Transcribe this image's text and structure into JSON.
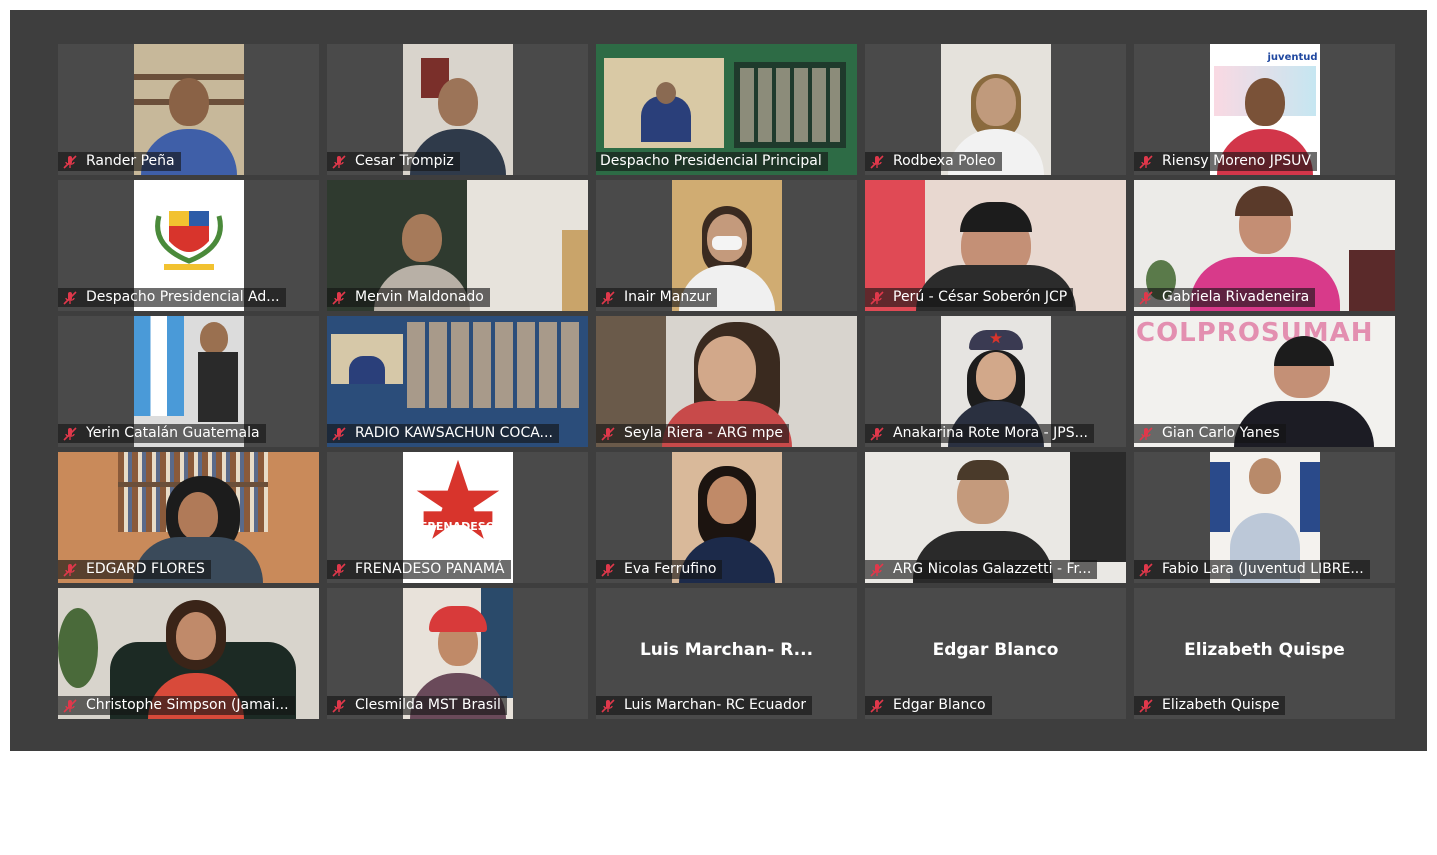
{
  "meeting": {
    "tiles": [
      {
        "label": "Rander Peña",
        "muted": true
      },
      {
        "label": "Cesar Trompiz",
        "muted": true
      },
      {
        "label": "Despacho Presidencial Principal",
        "muted": false,
        "active": true
      },
      {
        "label": "Rodbexa Poleo",
        "muted": true
      },
      {
        "label": "Riensy Moreno  JPSUV",
        "muted": true
      },
      {
        "label": "Despacho Presidencial Ad...",
        "muted": true
      },
      {
        "label": "Mervin Maldonado",
        "muted": true
      },
      {
        "label": "Inair Manzur",
        "muted": true
      },
      {
        "label": "Perú - César Soberón JCP",
        "muted": true
      },
      {
        "label": "Gabriela Rivadeneira",
        "muted": true
      },
      {
        "label": "Yerin Catalán Guatemala",
        "muted": true
      },
      {
        "label": "RADIO KAWSACHUN COCA...",
        "muted": true
      },
      {
        "label": "Seyla Riera - ARG mpe",
        "muted": true
      },
      {
        "label": "Anakarina Rote Mora - JPS...",
        "muted": true
      },
      {
        "label": "Gian Carlo Yanes",
        "muted": true
      },
      {
        "label": "EDGARD FLORES",
        "muted": true
      },
      {
        "label": "FRENADESO PANAMÁ",
        "muted": true
      },
      {
        "label": "Eva Ferrufino",
        "muted": true
      },
      {
        "label": "ARG Nicolas Galazzetti - Fr...",
        "muted": true
      },
      {
        "label": "Fabio Lara (Juventud LIBRE...",
        "muted": true
      },
      {
        "label": "Christophe Simpson (Jamai...",
        "muted": true
      },
      {
        "label": "Clesmilda MST Brasil",
        "muted": true
      },
      {
        "label": "Luis Marchan- RC Ecuador",
        "muted": true,
        "center_name": "Luis  Marchan-  R..."
      },
      {
        "label": "Edgar Blanco",
        "muted": true,
        "center_name": "Edgar Blanco"
      },
      {
        "label": "Elizabeth Quispe",
        "muted": true,
        "center_name": "Elizabeth Quispe"
      }
    ],
    "logo_text": {
      "frenadeso": "FRENADESO",
      "colprosumah": "COLPROSUMAH",
      "juventud": "juventud"
    }
  },
  "colors": {
    "background": "#3e3e3e",
    "tile": "#4a4a4a",
    "active_border": "#e6e29a",
    "muted_icon": "#e0384b"
  }
}
